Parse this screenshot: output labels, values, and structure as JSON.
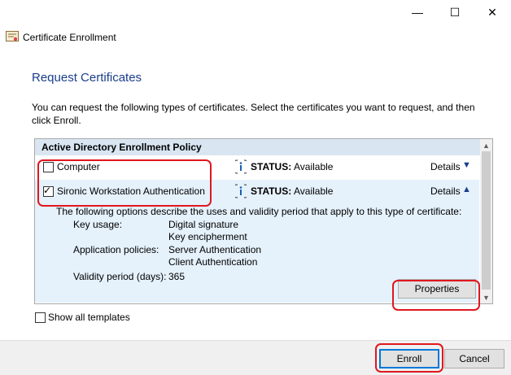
{
  "window": {
    "title": "Certificate Enrollment",
    "controls": {
      "minimize": "—",
      "maximize": "☐",
      "close": "✕"
    }
  },
  "page": {
    "heading": "Request Certificates",
    "intro": "You can request the following types of certificates. Select the certificates you want to request, and then click Enroll."
  },
  "policy": {
    "header": "Active Directory Enrollment Policy",
    "rows": [
      {
        "label": "Computer",
        "checked": false,
        "status_key": "STATUS:",
        "status_value": "Available",
        "details_label": "Details",
        "expanded": false
      },
      {
        "label": "Sironic Workstation Authentication",
        "checked": true,
        "status_key": "STATUS:",
        "status_value": "Available",
        "details_label": "Details",
        "expanded": true
      }
    ],
    "details": {
      "description": "The following options describe the uses and validity period that apply to this type of certificate:",
      "key_usage_label": "Key usage:",
      "key_usage_values": [
        "Digital signature",
        "Key encipherment"
      ],
      "app_policies_label": "Application policies:",
      "app_policies_values": [
        "Server Authentication",
        "Client Authentication"
      ],
      "validity_label": "Validity period (days):",
      "validity_value": "365",
      "properties_button": "Properties"
    }
  },
  "show_all_templates": {
    "label": "Show all templates",
    "checked": false
  },
  "footer": {
    "enroll": "Enroll",
    "cancel": "Cancel"
  },
  "colors": {
    "heading": "#1a3e8c",
    "highlight": "#e0171f",
    "selection": "#e5f1fb"
  }
}
